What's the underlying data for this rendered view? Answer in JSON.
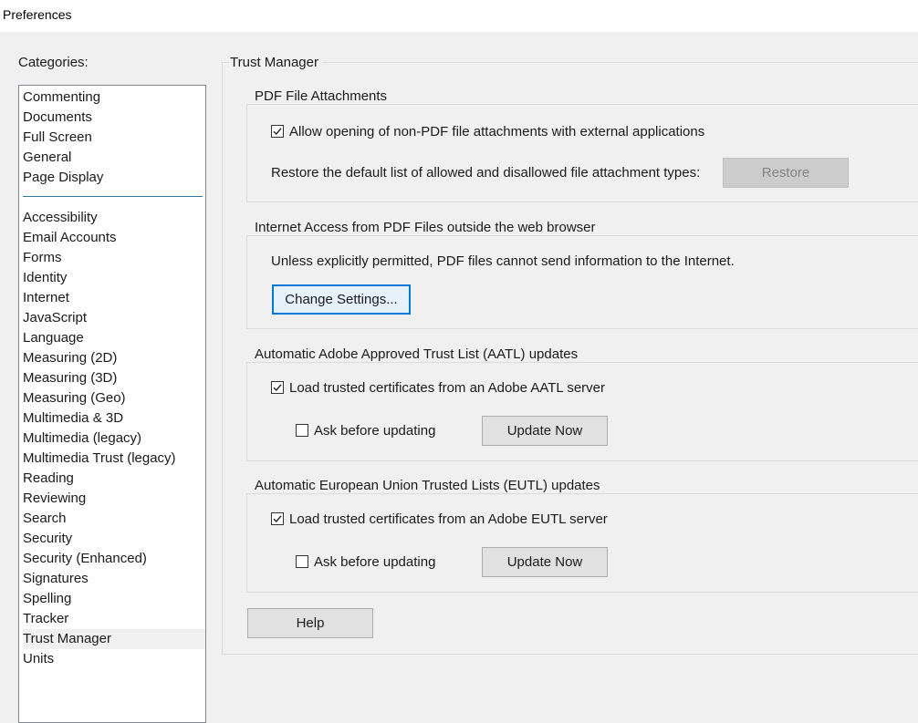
{
  "window": {
    "title": "Preferences"
  },
  "categories": {
    "label": "Categories:",
    "group1": [
      "Commenting",
      "Documents",
      "Full Screen",
      "General",
      "Page Display"
    ],
    "group2": [
      "Accessibility",
      "Email Accounts",
      "Forms",
      "Identity",
      "Internet",
      "JavaScript",
      "Language",
      "Measuring (2D)",
      "Measuring (3D)",
      "Measuring (Geo)",
      "Multimedia & 3D",
      "Multimedia (legacy)",
      "Multimedia Trust (legacy)",
      "Reading",
      "Reviewing",
      "Search",
      "Security",
      "Security (Enhanced)",
      "Signatures",
      "Spelling",
      "Tracker",
      "Trust Manager",
      "Units"
    ],
    "selected": "Trust Manager"
  },
  "panel": {
    "title": "Trust Manager",
    "attachments": {
      "title": "PDF File Attachments",
      "allow_label": "Allow opening of non-PDF file attachments with external applications",
      "allow_checked": true,
      "restore_text": "Restore the default list of allowed and disallowed file attachment types:",
      "restore_button": "Restore"
    },
    "internet": {
      "title": "Internet Access from PDF Files outside the web browser",
      "info": "Unless explicitly permitted, PDF files cannot send information to the Internet.",
      "change_button": "Change Settings..."
    },
    "aatl": {
      "title": "Automatic Adobe Approved Trust List (AATL) updates",
      "load_label": "Load trusted certificates from an Adobe AATL server",
      "load_checked": true,
      "ask_label": "Ask before updating",
      "ask_checked": false,
      "update_button": "Update Now"
    },
    "eutl": {
      "title": "Automatic European Union Trusted Lists (EUTL) updates",
      "load_label": "Load trusted certificates from an Adobe EUTL server",
      "load_checked": true,
      "ask_label": "Ask before updating",
      "ask_checked": false,
      "update_button": "Update Now"
    },
    "help_button": "Help"
  }
}
